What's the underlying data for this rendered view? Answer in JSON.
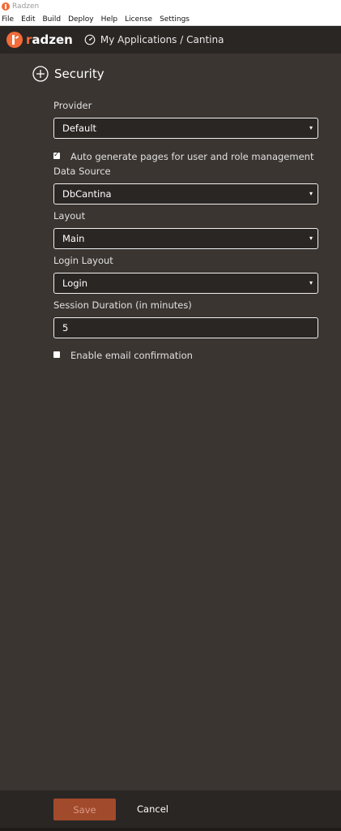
{
  "window": {
    "title": "Radzen"
  },
  "menu": [
    "File",
    "Edit",
    "Build",
    "Deploy",
    "Help",
    "License",
    "Settings"
  ],
  "header": {
    "logo_r": "r",
    "logo_rest": "adzen",
    "breadcrumb": "My Applications / Cantina"
  },
  "section": {
    "title": "Security"
  },
  "form": {
    "provider": {
      "label": "Provider",
      "value": "Default"
    },
    "auto_generate": {
      "label": "Auto generate pages for user and role management",
      "checked": true
    },
    "data_source": {
      "label": "Data Source",
      "value": "DbCantina"
    },
    "layout": {
      "label": "Layout",
      "value": "Main"
    },
    "login_layout": {
      "label": "Login Layout",
      "value": "Login"
    },
    "session_duration": {
      "label": "Session Duration (in minutes)",
      "value": "5"
    },
    "email_confirmation": {
      "label": "Enable email confirmation",
      "checked": false
    }
  },
  "footer": {
    "save": "Save",
    "cancel": "Cancel"
  },
  "colors": {
    "accent": "#f26b38",
    "background": "#3a3531",
    "panel": "#2a2624",
    "save_button": "#a24a2c"
  },
  "icons": {
    "caret": "▾",
    "check": "✓"
  }
}
